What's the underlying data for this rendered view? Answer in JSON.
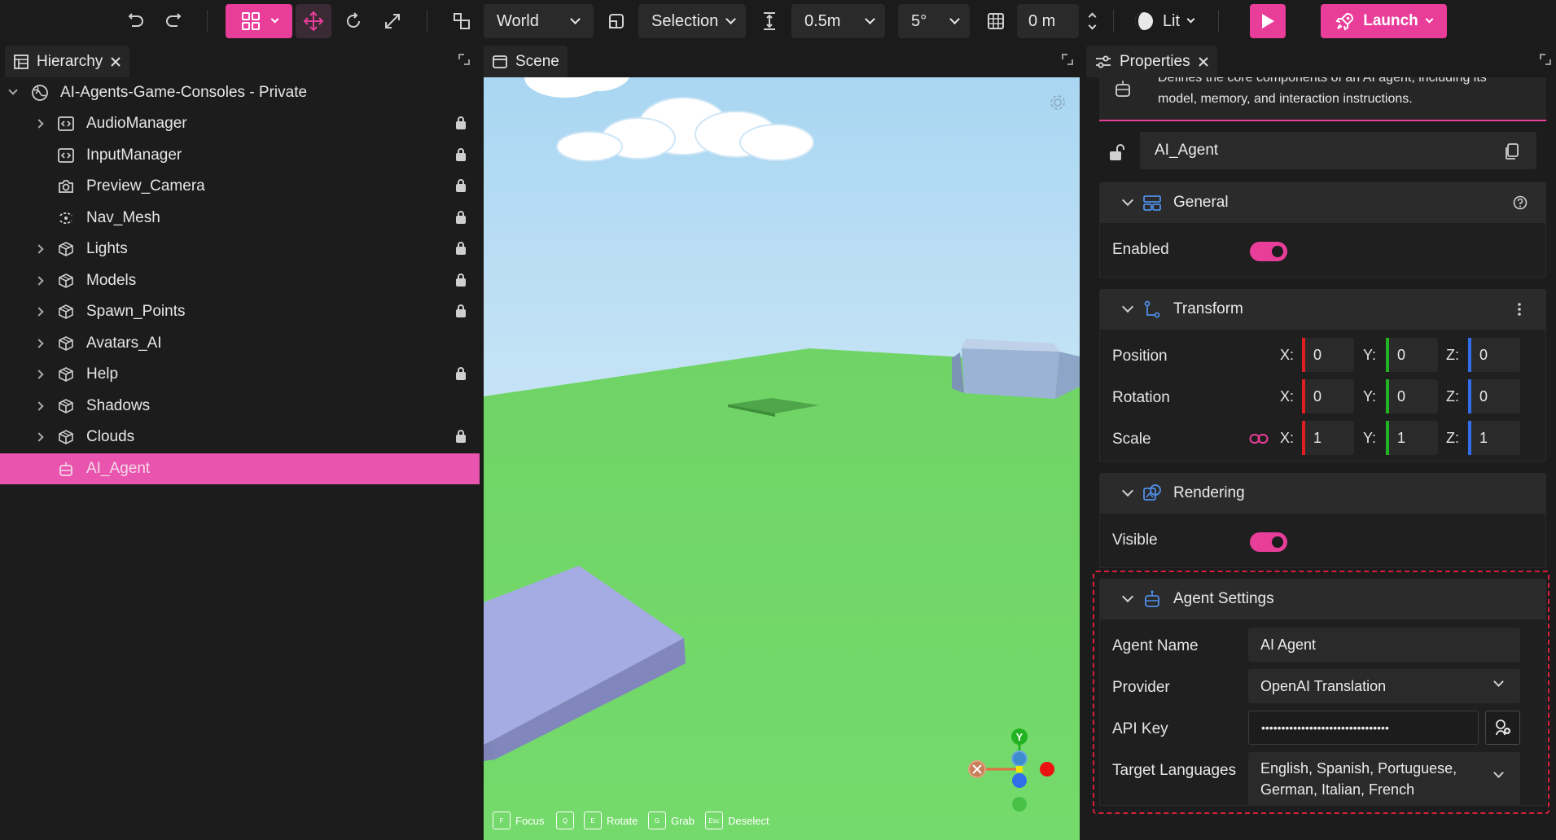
{
  "toolbar": {
    "space": "World",
    "pivot": "Selection",
    "snap_move": "0.5m",
    "snap_rotate": "5°",
    "grid_offset": "0 m",
    "lighting": "Lit",
    "launch_label": "Launch"
  },
  "panels": {
    "hierarchy_title": "Hierarchy",
    "scene_title": "Scene",
    "properties_title": "Properties"
  },
  "hierarchy": {
    "root": "AI-Agents-Game-Consoles - Private",
    "items": [
      {
        "label": "AudioManager",
        "icon": "script-icon",
        "expandable": true,
        "locked": true
      },
      {
        "label": "InputManager",
        "icon": "script-icon",
        "expandable": false,
        "locked": true
      },
      {
        "label": "Preview_Camera",
        "icon": "camera-icon",
        "expandable": false,
        "locked": true
      },
      {
        "label": "Nav_Mesh",
        "icon": "navmesh-icon",
        "expandable": false,
        "locked": true
      },
      {
        "label": "Lights",
        "icon": "group-icon",
        "expandable": true,
        "locked": true
      },
      {
        "label": "Models",
        "icon": "group-icon",
        "expandable": true,
        "locked": true
      },
      {
        "label": "Spawn_Points",
        "icon": "group-icon",
        "expandable": true,
        "locked": true
      },
      {
        "label": "Avatars_AI",
        "icon": "group-icon",
        "expandable": true,
        "locked": false
      },
      {
        "label": "Help",
        "icon": "group-icon",
        "expandable": true,
        "locked": true
      },
      {
        "label": "Shadows",
        "icon": "group-icon",
        "expandable": true,
        "locked": false
      },
      {
        "label": "Clouds",
        "icon": "group-icon",
        "expandable": true,
        "locked": true
      },
      {
        "label": "AI_Agent",
        "icon": "robot-icon",
        "expandable": false,
        "locked": false,
        "selected": true
      }
    ]
  },
  "scene": {
    "hints": [
      {
        "key": "F",
        "label": "Focus"
      },
      {
        "key": "Q",
        "label": ""
      },
      {
        "key": "E",
        "label": "Rotate"
      },
      {
        "key": "G",
        "label": "Grab"
      },
      {
        "key": "Esc",
        "label": "Deselect"
      }
    ],
    "gizmo_y": "Y"
  },
  "properties": {
    "description": "Defines the core components of an AI agent, including its model, memory, and interaction instructions.",
    "entity_name": "AI_Agent",
    "general": {
      "title": "General",
      "enabled_label": "Enabled"
    },
    "transform": {
      "title": "Transform",
      "position_label": "Position",
      "rotation_label": "Rotation",
      "scale_label": "Scale",
      "position": {
        "x": "0",
        "y": "0",
        "z": "0"
      },
      "rotation": {
        "x": "0",
        "y": "0",
        "z": "0"
      },
      "scale": {
        "x": "1",
        "y": "1",
        "z": "1"
      }
    },
    "rendering": {
      "title": "Rendering",
      "visible_label": "Visible"
    },
    "agent_settings": {
      "title": "Agent Settings",
      "agent_name_label": "Agent Name",
      "agent_name_value": "AI Agent",
      "provider_label": "Provider",
      "provider_value": "OpenAI Translation",
      "api_key_label": "API Key",
      "api_key_value": "••••••••••••••••••••••••••••••••",
      "target_languages_label": "Target Languages",
      "target_languages_line1": "English, Spanish, Portuguese,",
      "target_languages_line2": "German, Italian, French"
    }
  },
  "colors": {
    "accent": "#e93d9a",
    "axis_x": "#e02020",
    "axis_y": "#22b322",
    "axis_z": "#2f6ee8"
  }
}
